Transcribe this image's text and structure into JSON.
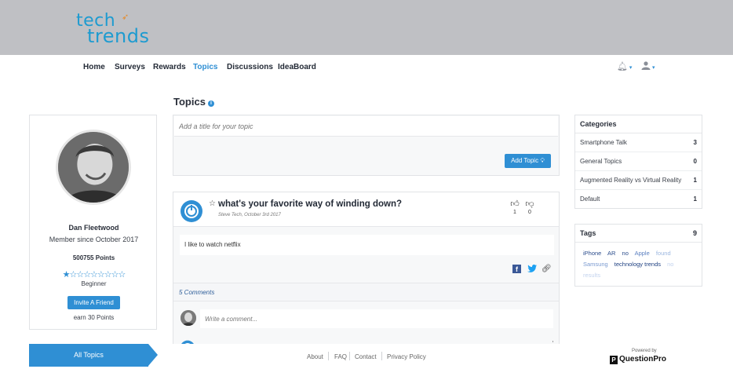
{
  "brand": {
    "line1": "tech",
    "line2": "trends",
    "accent": "#1e9bd0"
  },
  "nav": {
    "items": [
      {
        "label": "Home"
      },
      {
        "label": "Surveys"
      },
      {
        "label": "Rewards"
      },
      {
        "label": "Topics",
        "active": true
      },
      {
        "label": "Discussions"
      },
      {
        "label": "IdeaBoard"
      }
    ],
    "icons": [
      "bell-icon",
      "user-icon"
    ]
  },
  "page": {
    "title": "Topics"
  },
  "profile": {
    "name": "Dan Fleetwood",
    "member_since": "Member since October 2017",
    "points": "500755 Points",
    "stars": "★☆☆☆☆☆☆☆☆",
    "rating": {
      "filled": 1,
      "total": 9
    },
    "level": "Beginner",
    "invite_label": "Invite A Friend",
    "earn": "earn 30 Points"
  },
  "add_topic": {
    "placeholder": "Add a title for your topic",
    "button_label": "Add Topic"
  },
  "post": {
    "star": "☆",
    "title": "what's your favorite way of winding down?",
    "meta": "Steve Tech, October 3rd 2017",
    "upvotes": "1",
    "downvotes": "0",
    "body": "I like to watch netflix",
    "comments_label": "5 Comments",
    "comment_placeholder": "Write a comment..."
  },
  "categories": {
    "title": "Categories",
    "items": [
      {
        "name": "Smartphone Talk",
        "count": "3"
      },
      {
        "name": "General Topics",
        "count": "0"
      },
      {
        "name": "Augmented Reality vs Virtual Reality",
        "count": "1"
      },
      {
        "name": "Default",
        "count": "1"
      }
    ]
  },
  "tags": {
    "title": "Tags",
    "count": "9",
    "items": [
      {
        "label": "iPhone",
        "color": "#2b4c8c"
      },
      {
        "label": "AR",
        "color": "#2b4c8c"
      },
      {
        "label": "no",
        "color": "#2b4c8c"
      },
      {
        "label": "Apple",
        "color": "#5b7fc0"
      },
      {
        "label": "found",
        "color": "#9cb7e0"
      },
      {
        "label": "Samsung",
        "color": "#7a9ad0"
      },
      {
        "label": "technology trends",
        "color": "#1d3f80"
      },
      {
        "label": "no",
        "color": "#c3d3ee"
      },
      {
        "label": "results",
        "color": "#c3d3ee"
      }
    ]
  },
  "footer": {
    "all_topics": "All Topics",
    "links": [
      "About",
      "FAQ",
      "Contact",
      "Privacy Policy"
    ],
    "powered_by": "Powered by",
    "powered_brand": "QuestionPro",
    "powered_mark": "P"
  },
  "colors": {
    "primary": "#2f8fd4",
    "banner": "#bfc0c4"
  }
}
